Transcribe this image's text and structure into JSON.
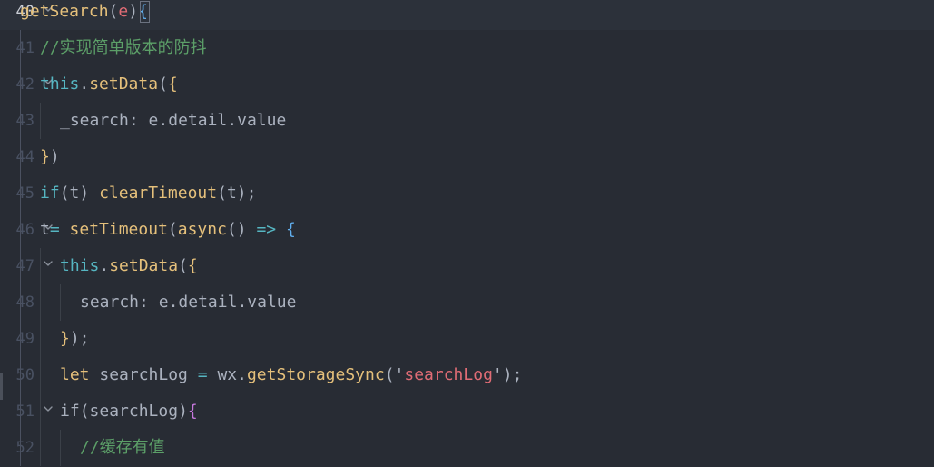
{
  "editor": {
    "lines": [
      {
        "number": "40",
        "current": true,
        "fold": true,
        "indent": 0,
        "tokens": [
          {
            "text": "getSearch",
            "type": "fn"
          },
          {
            "text": "(",
            "type": "punc"
          },
          {
            "text": "e",
            "type": "param"
          },
          {
            "text": ")",
            "type": "punc"
          },
          {
            "text": "{",
            "type": "brace-blue"
          }
        ]
      },
      {
        "number": "41",
        "current": false,
        "fold": false,
        "indent": 1,
        "tokens": [
          {
            "text": "//实现简单版本的防抖",
            "type": "comment cn"
          }
        ]
      },
      {
        "number": "42",
        "current": false,
        "fold": true,
        "indent": 1,
        "tokens": [
          {
            "text": "this",
            "type": "kw"
          },
          {
            "text": ".",
            "type": "punc"
          },
          {
            "text": "setData",
            "type": "fn"
          },
          {
            "text": "(",
            "type": "punc"
          },
          {
            "text": "{",
            "type": "brace-yellow"
          }
        ]
      },
      {
        "number": "43",
        "current": false,
        "fold": false,
        "indent": 2,
        "tokens": [
          {
            "text": "_search",
            "type": "prop"
          },
          {
            "text": ": ",
            "type": "punc"
          },
          {
            "text": "e",
            "type": "var"
          },
          {
            "text": ".",
            "type": "punc"
          },
          {
            "text": "detail",
            "type": "prop"
          },
          {
            "text": ".",
            "type": "punc"
          },
          {
            "text": "value",
            "type": "prop"
          }
        ]
      },
      {
        "number": "44",
        "current": false,
        "fold": false,
        "indent": 1,
        "tokens": [
          {
            "text": "}",
            "type": "brace-yellow"
          },
          {
            "text": ")",
            "type": "punc"
          }
        ]
      },
      {
        "number": "45",
        "current": false,
        "fold": false,
        "indent": 1,
        "tokens": [
          {
            "text": "if",
            "type": "kw"
          },
          {
            "text": "(",
            "type": "punc"
          },
          {
            "text": "t",
            "type": "var"
          },
          {
            "text": ") ",
            "type": "punc"
          },
          {
            "text": "clearTimeout",
            "type": "fn"
          },
          {
            "text": "(",
            "type": "punc"
          },
          {
            "text": "t",
            "type": "var"
          },
          {
            "text": ");",
            "type": "punc"
          }
        ]
      },
      {
        "number": "46",
        "current": false,
        "fold": true,
        "indent": 1,
        "tokens": [
          {
            "text": "t",
            "type": "var"
          },
          {
            "text": "= ",
            "type": "op"
          },
          {
            "text": "setTimeout",
            "type": "fn"
          },
          {
            "text": "(",
            "type": "punc"
          },
          {
            "text": "async",
            "type": "fn"
          },
          {
            "text": "() ",
            "type": "punc"
          },
          {
            "text": "=>",
            "type": "op"
          },
          {
            "text": " ",
            "type": "punc"
          },
          {
            "text": "{",
            "type": "brace-blue"
          }
        ]
      },
      {
        "number": "47",
        "current": false,
        "fold": true,
        "indent": 2,
        "tokens": [
          {
            "text": "this",
            "type": "kw"
          },
          {
            "text": ".",
            "type": "punc"
          },
          {
            "text": "setData",
            "type": "fn"
          },
          {
            "text": "(",
            "type": "punc"
          },
          {
            "text": "{",
            "type": "brace-yellow"
          }
        ]
      },
      {
        "number": "48",
        "current": false,
        "fold": false,
        "indent": 3,
        "tokens": [
          {
            "text": "search",
            "type": "prop"
          },
          {
            "text": ": ",
            "type": "punc"
          },
          {
            "text": "e",
            "type": "var"
          },
          {
            "text": ".",
            "type": "punc"
          },
          {
            "text": "detail",
            "type": "prop"
          },
          {
            "text": ".",
            "type": "punc"
          },
          {
            "text": "value",
            "type": "prop"
          }
        ]
      },
      {
        "number": "49",
        "current": false,
        "fold": false,
        "indent": 2,
        "tokens": [
          {
            "text": "}",
            "type": "brace-yellow"
          },
          {
            "text": ");",
            "type": "punc"
          }
        ]
      },
      {
        "number": "50",
        "current": false,
        "fold": false,
        "indent": 2,
        "tokens": [
          {
            "text": "let",
            "type": "fn"
          },
          {
            "text": " ",
            "type": "punc"
          },
          {
            "text": "searchLog",
            "type": "var"
          },
          {
            "text": " ",
            "type": "punc"
          },
          {
            "text": "=",
            "type": "op"
          },
          {
            "text": " ",
            "type": "punc"
          },
          {
            "text": "wx",
            "type": "var"
          },
          {
            "text": ".",
            "type": "punc"
          },
          {
            "text": "getStorageSync",
            "type": "fn"
          },
          {
            "text": "(",
            "type": "punc"
          },
          {
            "text": "'",
            "type": "punc"
          },
          {
            "text": "searchLog",
            "type": "fn2"
          },
          {
            "text": "'",
            "type": "punc"
          },
          {
            "text": ");",
            "type": "punc"
          }
        ]
      },
      {
        "number": "51",
        "current": false,
        "fold": true,
        "indent": 2,
        "tokens": [
          {
            "text": "if",
            "type": "var"
          },
          {
            "text": "(",
            "type": "punc"
          },
          {
            "text": "searchLog",
            "type": "var"
          },
          {
            "text": ")",
            "type": "punc"
          },
          {
            "text": "{",
            "type": "brace-purple"
          }
        ]
      },
      {
        "number": "52",
        "current": false,
        "fold": false,
        "indent": 3,
        "tokens": [
          {
            "text": "//缓存有值",
            "type": "comment cn"
          }
        ]
      }
    ]
  },
  "colors": {
    "background": "#282c34",
    "current_line": "#2c313a",
    "line_number": "#495162",
    "line_number_current": "#c8ccd4",
    "keyword": "#56b6c2",
    "function": "#e5c07b",
    "comment": "#5c9f68",
    "string": "#e06c75",
    "text": "#abb2bf"
  },
  "icons": {
    "fold": "chevron-down-icon"
  }
}
